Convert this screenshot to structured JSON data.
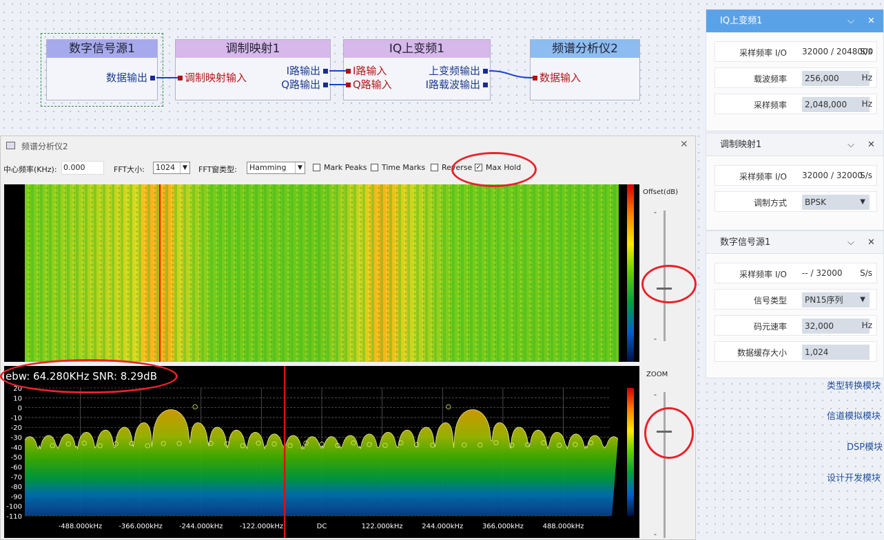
{
  "flow": {
    "nodes": [
      {
        "title": "数字信号源1",
        "outputs": [
          "数据输出"
        ]
      },
      {
        "title": "调制映射1",
        "inputs": [
          "调制映射输入"
        ],
        "outputs": [
          "I路输出",
          "Q路输出"
        ]
      },
      {
        "title": "IQ上变频1",
        "inputs": [
          "I路输入",
          "Q路输入"
        ],
        "outputs": [
          "上变频输出",
          "I路载波输出"
        ]
      },
      {
        "title": "频谱分析仪2",
        "inputs": [
          "数据输入"
        ]
      }
    ]
  },
  "analyzer": {
    "window_title": "频谱分析仪2",
    "center_freq_label": "中心频率(KHz):",
    "center_freq_value": "0.000",
    "fft_size_label": "FFT大小:",
    "fft_size_value": "1024",
    "fft_window_label": "FFT窗类型:",
    "fft_window_value": "Hamming",
    "checkboxes": [
      {
        "label": "Mark Peaks",
        "checked": false
      },
      {
        "label": "Time Marks",
        "checked": false
      },
      {
        "label": "Reverse",
        "checked": false
      },
      {
        "label": "Max Hold",
        "checked": true
      }
    ],
    "offset_label": "Offset(dB)",
    "zoom_label": "ZOOM",
    "slider_tick": "-",
    "measurement": "ebw: 64.280KHz SNR: 8.29dB"
  },
  "chart_data": {
    "type": "line",
    "x_tick_labels": [
      "-488.000kHz",
      "-366.000kHz",
      "-244.000kHz",
      "-122.000kHz",
      "DC",
      "122.000kHz",
      "244.000kHz",
      "366.000kHz",
      "488.000kHz"
    ],
    "y_tick_labels": [
      "20",
      "10",
      "0",
      "-10",
      "-20",
      "-30",
      "-40",
      "-50",
      "-60",
      "-70",
      "-80",
      "-90",
      "-100",
      "-110"
    ],
    "ylim": [
      -110,
      20
    ],
    "xlim": [
      -600,
      600
    ],
    "cursor_x": -75,
    "peak_centers_khz": [
      -256,
      256
    ],
    "peak_level_db": -2,
    "sidelobe_level_db": -40,
    "series": [
      {
        "values": "spectrum trace (BPSK upconverted, mainlobes near ±256 kHz)"
      }
    ]
  },
  "panels": [
    {
      "title": "IQ上变频1",
      "rows": [
        {
          "label": "采样频率 I/O",
          "value": "32000 / 2048000",
          "unit": "S/s",
          "kind": "text"
        },
        {
          "label": "载波频率",
          "value": "256,000",
          "unit": "Hz",
          "kind": "box"
        },
        {
          "label": "采样频率",
          "value": "2,048,000",
          "unit": "Hz",
          "kind": "box"
        }
      ]
    },
    {
      "title": "调制映射1",
      "rows": [
        {
          "label": "采样频率 I/O",
          "value": "32000 / 32000",
          "unit": "S/s",
          "kind": "text"
        },
        {
          "label": "调制方式",
          "value": "BPSK",
          "unit": "",
          "kind": "dropdown"
        }
      ]
    },
    {
      "title": "数字信号源1",
      "rows": [
        {
          "label": "采样频率 I/O",
          "value": "-- / 32000",
          "unit": "S/s",
          "kind": "text"
        },
        {
          "label": "信号类型",
          "value": "PN15序列",
          "unit": "",
          "kind": "dropdown"
        },
        {
          "label": "码元速率",
          "value": "32,000",
          "unit": "Hz",
          "kind": "box"
        },
        {
          "label": "数据缓存大小",
          "value": "1,024",
          "unit": "",
          "kind": "box"
        }
      ]
    }
  ],
  "panel_controls": {
    "collapse": "⌵",
    "close": "✕"
  },
  "modules": [
    "类型转换模块",
    "信道模拟模块",
    "DSP模块",
    "设计开发模块"
  ],
  "colors": {
    "accent": "#5aa2e8",
    "annotation": "#e8222b"
  }
}
